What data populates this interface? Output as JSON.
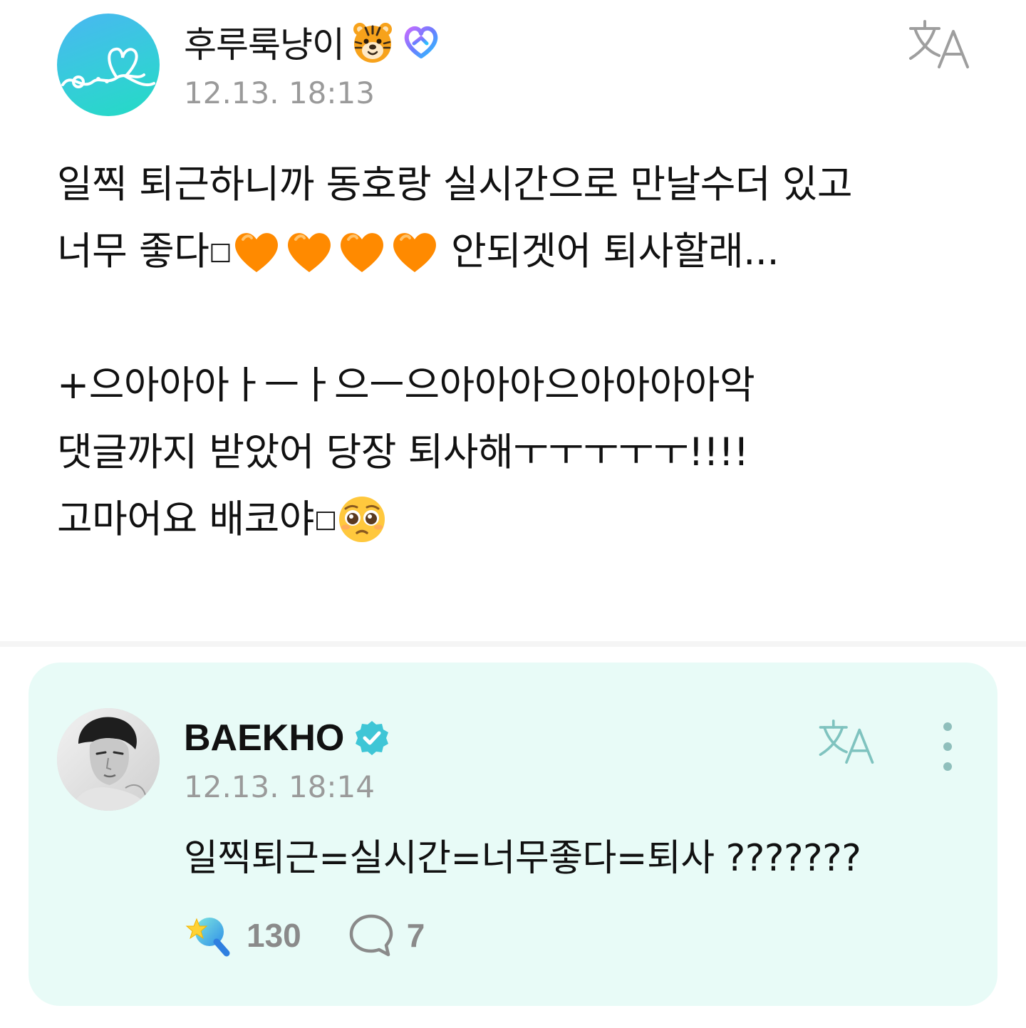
{
  "post": {
    "author_name": "후루룩냥이",
    "author_badges": [
      "tiger-face-emoji",
      "membership-heart-badge"
    ],
    "timestamp": "12.13. 18:13",
    "body": {
      "line1": "일찍 퇴근하니까 동호랑 실시간으로 만날수더 있고",
      "line2_text_before": "너무 좋다",
      "line2_text_after": "안되겟어 퇴사할래...",
      "line3": "+으아아아ㅏㅡㅏ으ㅡ으아아아으아아아아악",
      "line4": "댓글까지 받았어 당장 퇴사해ㅜㅜㅜㅜㅜ!!!!",
      "line5": "고마어요 배코야"
    },
    "missing_glyph": "□",
    "emojis": [
      "orange-heart",
      "orange-heart",
      "orange-heart",
      "orange-heart",
      "pleading-face"
    ]
  },
  "reply": {
    "author_name": "BAEKHO",
    "verified": true,
    "timestamp": "12.13. 18:14",
    "text": "일찍퇴근=실시간=너무좋다=퇴사 ???????",
    "like_count": "130",
    "comment_count": "7"
  },
  "colors": {
    "reply_background": "#e8fbf7",
    "accent_teal": "#35cdd9",
    "verified_badge": "#3fc6d6",
    "heart_orange": "#ff8a00",
    "timestamp_gray": "#9a9a9a"
  }
}
